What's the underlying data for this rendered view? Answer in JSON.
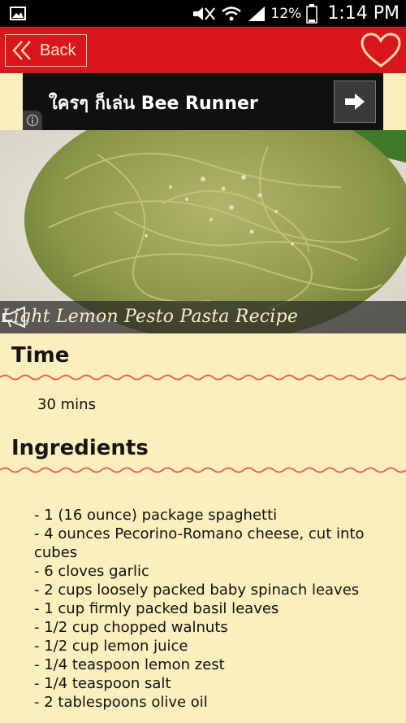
{
  "status_bar": {
    "battery_percent": "12%",
    "time": "1:14 PM"
  },
  "header": {
    "back_label": "Back",
    "favorite_icon": "heart-icon",
    "accent_color": "#d8161b"
  },
  "ad": {
    "text": "ใครๆ ก็เล่น Bee Runner",
    "arrow_icon": "arrow-right-icon",
    "info_icon": "info-icon"
  },
  "recipe": {
    "title": "Light Lemon Pesto Pasta Recipe",
    "share_icon": "megaphone-icon"
  },
  "time_section": {
    "heading": "Time",
    "value": "30 mins"
  },
  "ingredients_section": {
    "heading": "Ingredients",
    "items": [
      " -  1 (16 ounce) package spaghetti",
      " -  4 ounces Pecorino-Romano cheese, cut into cubes",
      " -  6 cloves garlic",
      " -  2 cups loosely packed baby spinach leaves",
      " -  1 cup firmly packed basil leaves",
      " -  1/2 cup chopped walnuts",
      " -  1/2 cup lemon juice",
      " -  1/4 teaspoon lemon zest",
      " -  1/4 teaspoon salt",
      " -  2 tablespoons olive oil"
    ]
  }
}
